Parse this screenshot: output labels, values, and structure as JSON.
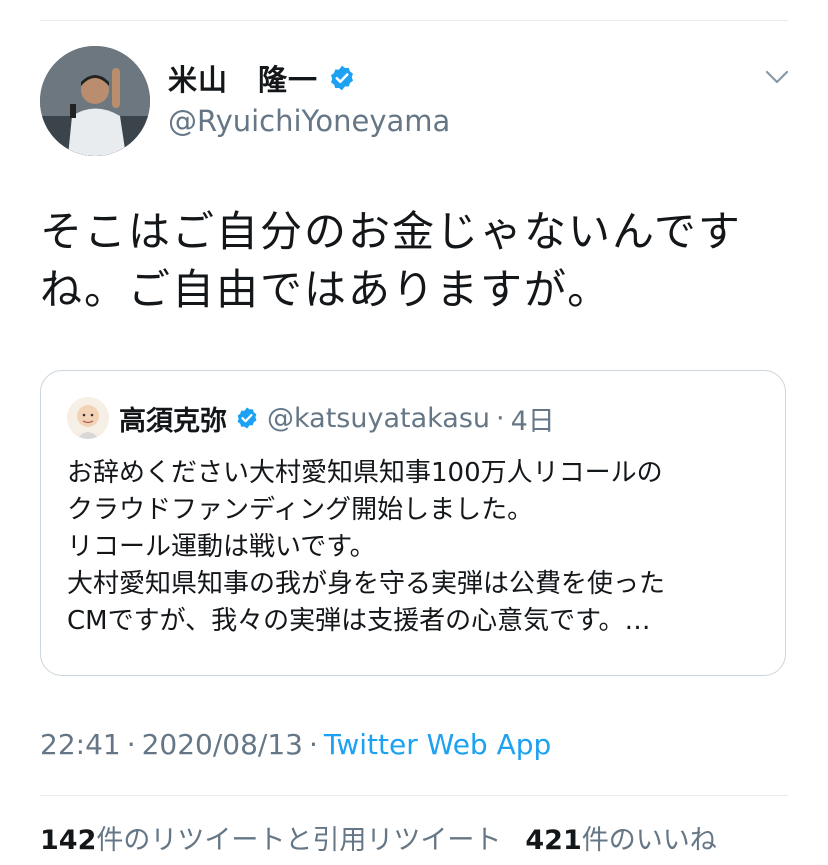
{
  "author": {
    "display_name": "米山　隆一",
    "handle": "@RyuichiYoneyama",
    "verified_icon": "verified-badge-icon",
    "avatar_icon": "user-avatar-photo"
  },
  "tweet": {
    "text": "そこはご自分のお金じゃないんです\nね。ご自由ではありますが。"
  },
  "quoted_tweet": {
    "display_name": "高須克弥",
    "handle": "@katsuyatakasu",
    "separator": "·",
    "date": "4日",
    "text": "お辞めください大村愛知県知事100万人リコールの\nクラウドファンディング開始しました。\nリコール運動は戦いです。\n大村愛知県知事の我が身を守る実弾は公費を使った\nCMですが、我々の実弾は支援者の心意気です。…"
  },
  "meta": {
    "time": "22:41",
    "dot1": "·",
    "date": "2020/08/13",
    "dot2": "·",
    "source": "Twitter Web App"
  },
  "stats": {
    "retweets_count": "142",
    "retweets_label": "件のリツイートと引用リツイート",
    "likes_count": "421",
    "likes_label": "件のいいね"
  },
  "colors": {
    "link": "#1da1f2",
    "secondary_text": "#657786",
    "border": "#ccd6dd",
    "verified": "#1da1f2"
  }
}
